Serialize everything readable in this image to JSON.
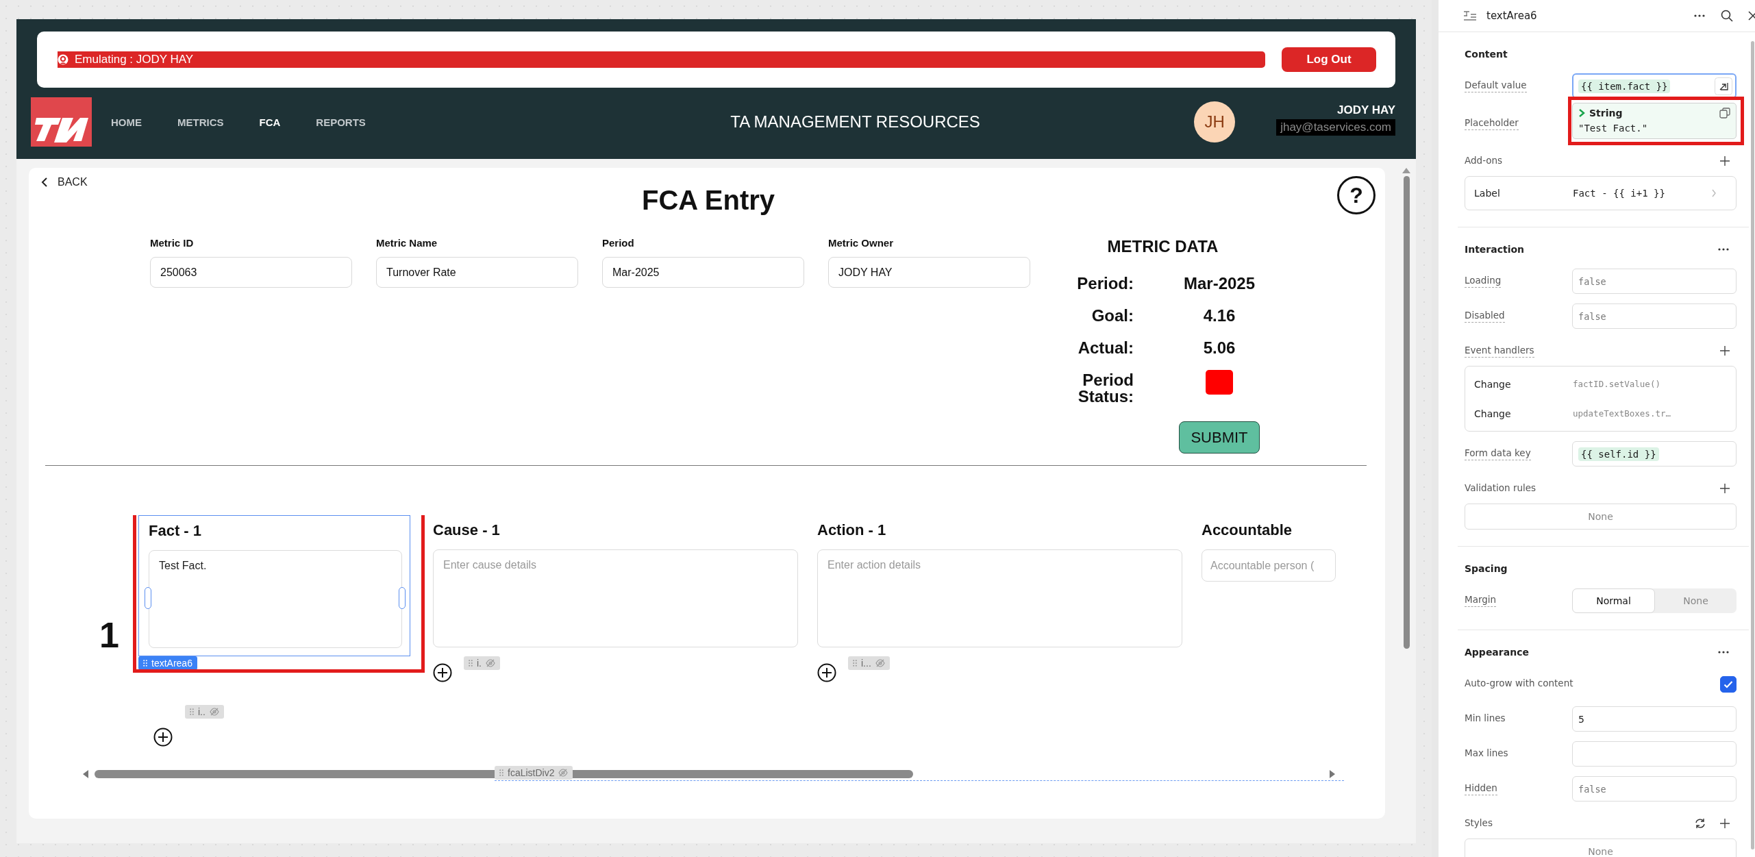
{
  "header": {
    "emulation": "Emulating : JODY HAY",
    "logout_button": "Log Out",
    "nav": [
      {
        "label": "HOME",
        "selected": false
      },
      {
        "label": "METRICS",
        "selected": false
      },
      {
        "label": "FCA",
        "selected": true
      },
      {
        "label": "REPORTS",
        "selected": false
      }
    ],
    "title": "TA MANAGEMENT RESOURCES",
    "user": {
      "initials": "JH",
      "name": "JODY HAY",
      "email": "jhay@taservices.com",
      "redacted": true
    }
  },
  "page": {
    "back_link": "BACK",
    "title": "FCA Entry",
    "help": "?",
    "fields": [
      {
        "label": "Metric ID",
        "value": "250063"
      },
      {
        "label": "Metric Name",
        "value": "Turnover Rate"
      },
      {
        "label": "Period",
        "value": "Mar-2025"
      },
      {
        "label": "Metric Owner",
        "value": "JODY HAY"
      }
    ],
    "metric_data": {
      "title": "METRIC DATA",
      "rows": [
        {
          "kind": "text",
          "label": "Period:",
          "value": "Mar-2025"
        },
        {
          "kind": "text",
          "label": "Goal:",
          "value": "4.16"
        },
        {
          "kind": "text",
          "label": "Actual:",
          "value": "5.06"
        },
        {
          "kind": "status",
          "label": "Period Status:",
          "color": "#ff0000"
        }
      ]
    },
    "submit_button": "SUBMIT",
    "fca": {
      "row_number": "1",
      "columns": [
        {
          "kind": "textarea",
          "label": "Fact - 1",
          "value": "Test Fact.",
          "selected": true,
          "component": "textArea6"
        },
        {
          "kind": "textarea",
          "label": "Cause - 1",
          "placeholder": "Enter cause details",
          "selected": false,
          "chip": "i."
        },
        {
          "kind": "textarea",
          "label": "Action - 1",
          "placeholder": "Enter action details",
          "selected": false,
          "chip": "i..."
        },
        {
          "kind": "input",
          "label": "Accountable",
          "placeholder": "Accountable person (",
          "selected": false
        }
      ],
      "row_chip": "i..",
      "container_chip": "fcaListDiv2"
    }
  },
  "inspector": {
    "title": "textArea6",
    "sections": [
      {
        "title": "Content",
        "more": false,
        "rows": [
          {
            "kind": "code",
            "label": "Default value",
            "hint": true,
            "code": "{{ item.fact }}",
            "focused": true
          },
          {
            "kind": "popover",
            "label": "Placeholder",
            "hint": true,
            "type": "String",
            "value": "\"Test Fact.\"",
            "highlighted": true
          },
          {
            "kind": "list_header",
            "label": "Add-ons",
            "hint": false,
            "add": true,
            "reset": false
          },
          {
            "kind": "addon",
            "label": "Label",
            "value": "Fact - {{ i+1 }}"
          }
        ]
      },
      {
        "title": "Interaction",
        "more": true,
        "rows": [
          {
            "kind": "field",
            "label": "Loading",
            "hint": true,
            "placeholder": "false"
          },
          {
            "kind": "field",
            "label": "Disabled",
            "hint": true,
            "placeholder": "false"
          },
          {
            "kind": "list_header",
            "label": "Event handlers",
            "hint": true,
            "add": true,
            "reset": false
          },
          {
            "kind": "events",
            "items": [
              {
                "event": "Change",
                "action": "factID.setValue()"
              },
              {
                "event": "Change",
                "action": "updateTextBoxes.tr…"
              }
            ]
          },
          {
            "kind": "code",
            "label": "Form data key",
            "hint": true,
            "code": "{{ self.id }}",
            "focused": false
          },
          {
            "kind": "list_header",
            "label": "Validation rules",
            "hint": false,
            "add": true,
            "reset": false
          },
          {
            "kind": "empty",
            "text": "None"
          }
        ]
      },
      {
        "title": "Spacing",
        "more": false,
        "rows": [
          {
            "kind": "segmented",
            "label": "Margin",
            "hint": true,
            "options": [
              {
                "label": "Normal",
                "selected": true
              },
              {
                "label": "None",
                "selected": false
              }
            ]
          }
        ]
      },
      {
        "title": "Appearance",
        "more": true,
        "rows": [
          {
            "kind": "checkbox",
            "label": "Auto-grow with content",
            "hint": false,
            "checked": true
          },
          {
            "kind": "field",
            "label": "Min lines",
            "hint": false,
            "value": "5"
          },
          {
            "kind": "field",
            "label": "Max lines",
            "hint": false
          },
          {
            "kind": "field",
            "label": "Hidden",
            "hint": true,
            "placeholder": "false"
          },
          {
            "kind": "list_header",
            "label": "Styles",
            "hint": false,
            "add": true,
            "reset": true
          },
          {
            "kind": "empty",
            "text": "None"
          }
        ]
      }
    ]
  }
}
